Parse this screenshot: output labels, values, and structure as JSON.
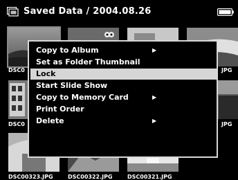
{
  "header": {
    "title": "Saved Data / 2004.08.26",
    "folder_icon": "folder-icon",
    "battery_icon": "battery-icon"
  },
  "thumbnails": [
    {
      "filename": "DSC0",
      "selected": true
    },
    {
      "filename": "",
      "selected": false
    },
    {
      "filename": "",
      "selected": false
    },
    {
      "filename": "JPG",
      "selected": false
    },
    {
      "filename": "DSC0",
      "selected": false
    },
    {
      "filename": "JPG",
      "selected": false
    },
    {
      "filename": "DSC00323.JPG",
      "selected": false
    },
    {
      "filename": "DSC00322.JPG",
      "selected": false
    },
    {
      "filename": "DSC00321.JPG",
      "selected": false
    }
  ],
  "menu": {
    "items": [
      {
        "label": "Copy to Album",
        "has_submenu": true,
        "highlighted": false
      },
      {
        "label": "Set as Folder Thumbnail",
        "has_submenu": false,
        "highlighted": false
      },
      {
        "label": "Lock",
        "has_submenu": false,
        "highlighted": true
      },
      {
        "label": "Start Slide Show",
        "has_submenu": false,
        "highlighted": false
      },
      {
        "label": "Copy to Memory Card",
        "has_submenu": true,
        "highlighted": false
      },
      {
        "label": "Print Order",
        "has_submenu": false,
        "highlighted": false
      },
      {
        "label": "Delete",
        "has_submenu": true,
        "highlighted": false
      }
    ],
    "submenu_glyph": "▶"
  },
  "colors": {
    "background": "#000000",
    "text": "#ffffff",
    "highlight": "#d6d6d6",
    "menu_border": "#d8d8d8"
  }
}
